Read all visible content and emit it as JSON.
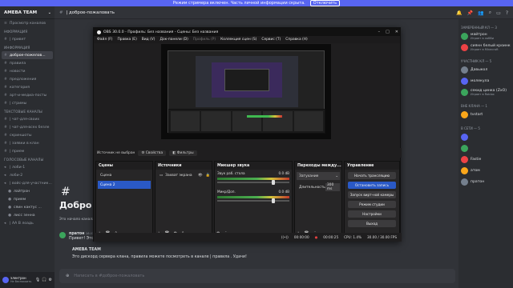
{
  "banner": {
    "text": "Режим стримера включен. Часть личной информации скрыта.",
    "button": "Отключить"
  },
  "server": {
    "name": "AMEBA TEAM"
  },
  "channels": [
    {
      "type": "row",
      "label": "Просмотр каналов",
      "icon": "≡"
    },
    {
      "type": "cat",
      "label": "НФОРМАЦИЯ"
    },
    {
      "type": "row",
      "label": "| привет",
      "icon": "#"
    },
    {
      "type": "cat",
      "label": "ИНФОРМАЦИЯ"
    },
    {
      "type": "sel",
      "label": "доброе-пожелов...",
      "icon": "#"
    },
    {
      "type": "row",
      "label": "правила",
      "icon": "#"
    },
    {
      "type": "row",
      "label": "новости",
      "icon": "#"
    },
    {
      "type": "row",
      "label": "предложения",
      "icon": "#"
    },
    {
      "type": "row",
      "label": "категория",
      "icon": "#"
    },
    {
      "type": "row",
      "label": "арт-и-медиа-посты",
      "icon": "#"
    },
    {
      "type": "row",
      "label": "| стримы",
      "icon": "#"
    },
    {
      "type": "cat",
      "label": "ТЕКСТОВЫЕ КАНАЛЫ"
    },
    {
      "type": "row",
      "label": "| чат-для-своих",
      "icon": "#"
    },
    {
      "type": "row",
      "label": "| чат-для-всех безле",
      "icon": "#"
    },
    {
      "type": "row",
      "label": "скриншоты",
      "icon": "#"
    },
    {
      "type": "row",
      "label": "| заявки в клан",
      "icon": "#"
    },
    {
      "type": "row",
      "label": "| прием",
      "icon": "#"
    },
    {
      "type": "cat",
      "label": "ГОЛОСОВЫЕ КАНАЛЫ"
    },
    {
      "type": "row",
      "label": "| лоби-1",
      "icon": "◂"
    },
    {
      "type": "row",
      "label": "лоби-2",
      "icon": "◂"
    },
    {
      "type": "row",
      "label": "| войс-для-участник...",
      "icon": "◂"
    },
    {
      "type": "user",
      "label": "лайтрон",
      "icon": "●"
    },
    {
      "type": "user",
      "label": "прием",
      "icon": "●"
    },
    {
      "type": "user",
      "label": "сяин кактус ...",
      "icon": "●"
    },
    {
      "type": "user",
      "label": "лисс зенна",
      "icon": "●"
    },
    {
      "type": "row",
      "label": "| АА В лоадь",
      "icon": "◂"
    }
  ],
  "userbar": {
    "name": "электрон",
    "status": "Не беспокоить"
  },
  "topbar": {
    "channel": "| доброе-пожаловать"
  },
  "welcome": {
    "title": "Добро по",
    "sub": "Это начало канала"
  },
  "messages": [
    {
      "author": "пратон",
      "time": "16.01",
      "text": "Привет! Это..."
    },
    {
      "author": "AMEBA TEAM",
      "time": "",
      "text": "Это дискорд сервера клана, правила можете посмотреть в канале | правила . Удачи!"
    }
  ],
  "input": {
    "placeholder": "Написать в #доброе-пожаловать"
  },
  "members": [
    {
      "type": "cat",
      "label": "ЗАМЕРЕННЫЙ КЛ — 3"
    },
    {
      "type": "m",
      "name": "майтрон",
      "sub": "Играет в лобби"
    },
    {
      "type": "m",
      "name": "сиянн белый кроинк",
      "sub": "Играет в Minecraft"
    },
    {
      "type": "cat",
      "label": "УЧАСТНИК КЛ — 5"
    },
    {
      "type": "m",
      "name": "Давыкол",
      "sub": ""
    },
    {
      "type": "m",
      "name": "молекула",
      "sub": ""
    },
    {
      "type": "m",
      "name": "секид цинка (ZxO)",
      "sub": "Играет в Roblox"
    },
    {
      "type": "cat",
      "label": "ВНЕ КЛАНА — 1"
    },
    {
      "type": "m",
      "name": "tvstart",
      "sub": ""
    },
    {
      "type": "cat",
      "label": "В СЕТИ — 5"
    },
    {
      "type": "m",
      "name": "",
      "sub": ""
    },
    {
      "type": "m",
      "name": "",
      "sub": ""
    },
    {
      "type": "m",
      "name": "Fastie",
      "sub": ""
    },
    {
      "type": "m",
      "name": "атом",
      "sub": ""
    },
    {
      "type": "m",
      "name": "пратон",
      "sub": ""
    }
  ],
  "obs": {
    "title": "OBS 30.0.0 - Профиль: Без названия - Сцены: Без названия",
    "menu": [
      "Файл (F)",
      "Правка (E)",
      "Вид (V)",
      "Док-панели (D)",
      "Профиль (P)",
      "Коллекция сцен (S)",
      "Сервис (T)",
      "Справка (H)"
    ],
    "no_source": "Источник не выбран",
    "props": "Свойства",
    "filters": "Фильтры",
    "scenes_title": "Сцены",
    "scenes": [
      "Сцена",
      "Сцена 2"
    ],
    "sources_title": "Источники",
    "sources": [
      "Захват экрана"
    ],
    "mixer_title": "Микшер звука",
    "mixer": [
      {
        "name": "Звук раб. стола",
        "db": "0.0 dB"
      },
      {
        "name": "Микр/Доп.",
        "db": "0.0 dB"
      }
    ],
    "trans_title": "Переходы между...",
    "trans_value": "Затухание",
    "dur_label": "Длительность",
    "dur_value": "300 ms",
    "ctrl_title": "Управление",
    "controls": [
      "Начать трансляцию",
      "Остановить запись",
      "Запуск вирт-ной камеры",
      "Режим студии",
      "Настройки",
      "Выход"
    ],
    "status": {
      "rec": "00:00:25",
      "cpu": "CPU: 1.4%",
      "fps": "30.00 / 30.00 FPS",
      "live": "00:00:00"
    }
  }
}
